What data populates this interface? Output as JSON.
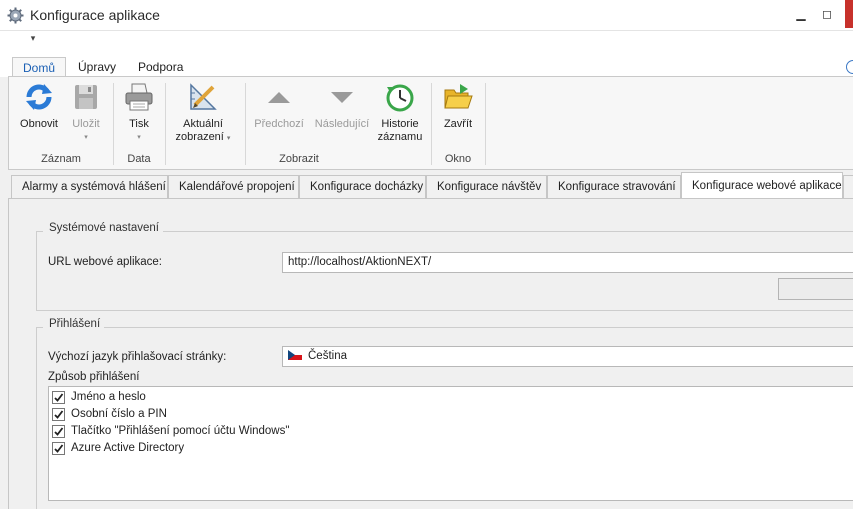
{
  "window": {
    "title": "Konfigurace aplikace",
    "minimize_glyph": "▁",
    "maximize_glyph": "◻"
  },
  "qat": {
    "dropdown_glyph": "▾"
  },
  "ribbon_tabs": [
    "Domů",
    "Úpravy",
    "Podpora"
  ],
  "ribbon": {
    "buttons": {
      "refresh": "Obnovit",
      "save": "Uložit",
      "print": "Tisk",
      "current_view_1": "Aktuální",
      "current_view_2": "zobrazení",
      "previous": "Předchozí",
      "next": "Následující",
      "history_1": "Historie",
      "history_2": "záznamu",
      "close": "Zavřít"
    },
    "groups": {
      "record": "Záznam",
      "data": "Data",
      "view": "Zobrazit",
      "window": "Okno"
    },
    "drop_glyph": "▾"
  },
  "content_tabs": [
    "Alarmy a systémová hlášení",
    "Kalendářové propojení",
    "Konfigurace docházky",
    "Konfigurace návštěv",
    "Konfigurace stravování",
    "Konfigurace webové aplikace"
  ],
  "system_settings": {
    "title": "Systémové nastavení",
    "url_label": "URL webové aplikace:",
    "url_value": "http://localhost/AktionNEXT/"
  },
  "login": {
    "title": "Přihlášení",
    "language_label": "Výchozí jazyk přihlašovací stránky:",
    "language_value": "Čeština",
    "method_label": "Způsob přihlášení",
    "methods": [
      {
        "label": "Jméno a heslo",
        "checked": true
      },
      {
        "label": "Osobní číslo a PIN",
        "checked": true
      },
      {
        "label": "Tlačítko \"Přihlášení pomocí účtu Windows\"",
        "checked": true
      },
      {
        "label": "Azure Active Directory",
        "checked": true
      }
    ]
  },
  "colors": {
    "accent": "#1a5fb4",
    "close_red": "#c7312b"
  }
}
